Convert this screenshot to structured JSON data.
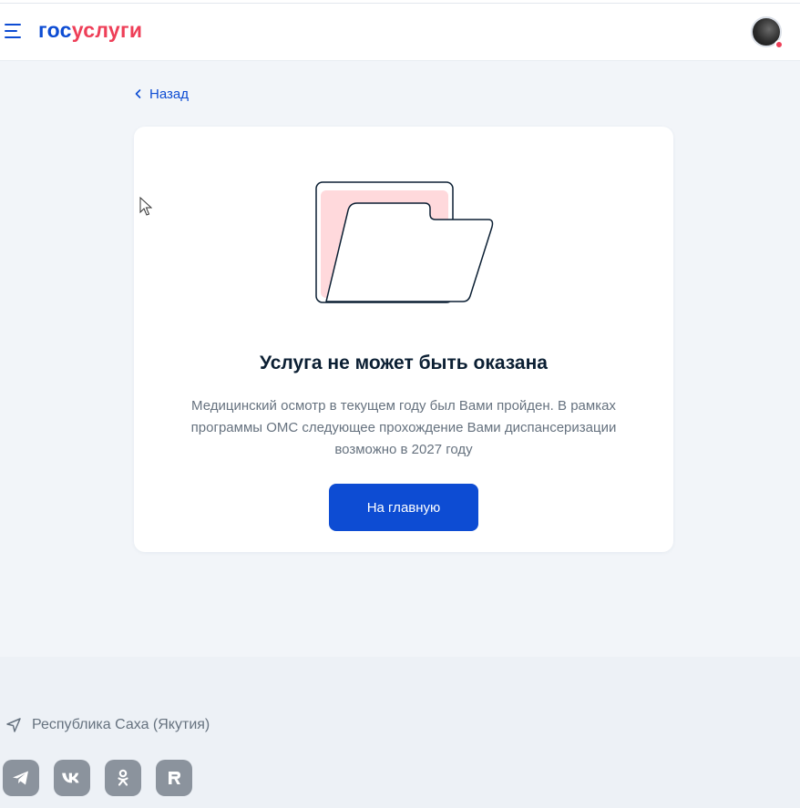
{
  "header": {
    "logo_part1": "гос",
    "logo_part2": "услуги",
    "menu_icon": "burger-menu-icon",
    "avatar_icon": "user-avatar"
  },
  "nav": {
    "back_label": "Назад"
  },
  "card": {
    "illustration": "empty-folder-illustration",
    "title": "Услуга не может быть оказана",
    "text": "Медицинский осмотр в текущем году был Вами пройден. В рамках программы ОМС следующее прохождение Вами диспансеризации возможно в 2027 году",
    "button_label": "На главную"
  },
  "footer": {
    "region": "Республика Саха (Якутия)",
    "socials": [
      "telegram-icon",
      "vk-icon",
      "odnoklassniki-icon",
      "rutube-icon"
    ]
  },
  "colors": {
    "primary": "#0d4cd3",
    "accent": "#ee3f58",
    "page_bg": "#f2f5f9",
    "text_dark": "#0b1f33",
    "text_muted": "#66727f"
  }
}
